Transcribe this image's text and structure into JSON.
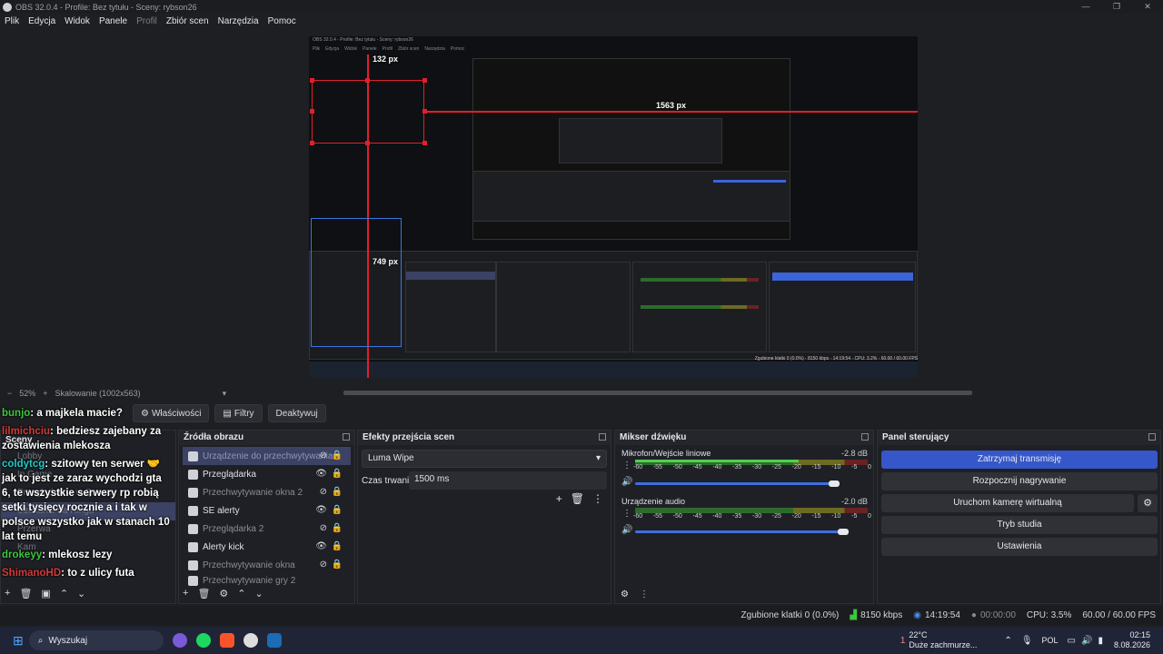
{
  "window": {
    "title": "OBS 32.0.4 - Profile: Bez tytułu - Sceny: rybson26",
    "minimize": "—",
    "maximize": "❐",
    "close": "✕"
  },
  "menu": [
    "Plik",
    "Edycja",
    "Widok",
    "Panele",
    "Profil",
    "Zbiór scen",
    "Narzędzia",
    "Pomoc"
  ],
  "preview": {
    "label_top": "132 px",
    "label_right": "1563 px",
    "label_bottom": "749 px",
    "inner_title": "OBS 32.0.4 - Profile: Bez tytułu - Sceny: rybson26",
    "inner_menu": [
      "Plik",
      "Edycja",
      "Widok",
      "Panele",
      "Profil",
      "Zbiór scen",
      "Narzędzia",
      "Pomoc"
    ],
    "inner_zoom": "52%",
    "inner_scale": "Skalowanie (1002x563)"
  },
  "zoombar": {
    "zoom": "52%",
    "scale": "Skalowanie (1002x563)",
    "minus": "−",
    "plus": "+"
  },
  "toolbar": {
    "properties": "Właściwości",
    "filters": "Filtry",
    "deactivate": "Deaktywuj"
  },
  "scenes": {
    "title": "Sceny",
    "items": [
      "Lobby",
      "In Game",
      "Przegląd neta w Queue",
      "Czekanie na Ringu",
      "Przerwa",
      "Kam"
    ]
  },
  "sources": {
    "title": "Źródła obrazu",
    "items": [
      {
        "name": "Urządzenie do przechwytywania",
        "visible": "hidden",
        "sel": true
      },
      {
        "name": "Przeglądarka",
        "visible": "shown"
      },
      {
        "name": "Przechwytywanie okna 2",
        "visible": "hidden"
      },
      {
        "name": "SE alerty",
        "visible": "shown"
      },
      {
        "name": "Przeglądarka 2",
        "visible": "hidden"
      },
      {
        "name": "Alerty kick",
        "visible": "shown"
      },
      {
        "name": "Przechwytywanie okna",
        "visible": "hidden"
      },
      {
        "name": "Przechwytywanie gry 2",
        "visible": "hidden"
      }
    ]
  },
  "transitions": {
    "title": "Efekty przejścia scen",
    "type": "Luma Wipe",
    "duration_label": "Czas trwania",
    "duration_value": "1500 ms"
  },
  "mixer": {
    "title": "Mikser dźwięku",
    "channels": [
      {
        "name": "Mikrofon/Wejście liniowe",
        "db": "-2.8 dB",
        "volume": 0.93
      },
      {
        "name": "Urządzenie audio",
        "db": "-2.0 dB",
        "volume": 0.97
      }
    ],
    "ticks": [
      "-60",
      "-55",
      "-50",
      "-45",
      "-40",
      "-35",
      "-30",
      "-25",
      "-20",
      "-15",
      "-10",
      "-5",
      "0"
    ]
  },
  "controls": {
    "title": "Panel sterujący",
    "buttons": [
      "Zatrzymaj transmisję",
      "Rozpocznij nagrywanie",
      "Uruchom kamerę wirtualną",
      "Tryb studia",
      "Ustawienia"
    ]
  },
  "status": {
    "dropped": "Zgubione klatki 0 (0.0%)",
    "bitrate": "8150 kbps",
    "stream_time": "14:19:54",
    "rec_time": "00:00:00",
    "cpu": "CPU: 3.5%",
    "fps": "60.00 / 60.00 FPS"
  },
  "chat": [
    {
      "user": "bunjo",
      "text": ": a majkela macie?",
      "color": "#3ec63e"
    },
    {
      "user": "lilmichciu",
      "text": ": bedziesz zajebany za zostawienia mlekosza",
      "color": "#d23b3b"
    },
    {
      "user": "coldytcg",
      "text": ": szitowy ten serwer 🤝 jak to jest ze zaraz wychodzi gta 6, te wszystkie serwery rp robią setki tysięcy rocznie a i tak w polsce wszystko jak w stanach 10 lat temu",
      "color": "#27c9c9"
    },
    {
      "user": "drokeyy",
      "text": ": mlekosz lezy",
      "color": "#3ec63e"
    },
    {
      "user": "ShimanoHD",
      "text": ": to z ulicy futa",
      "color": "#d23b3b"
    }
  ],
  "taskbar": {
    "search": "Wyszukaj",
    "weather_temp": "22°C",
    "weather_desc": "Duże zachmurze...",
    "lang": "POL",
    "time": "02:15",
    "date": "8.08.2026",
    "badge": "1"
  }
}
